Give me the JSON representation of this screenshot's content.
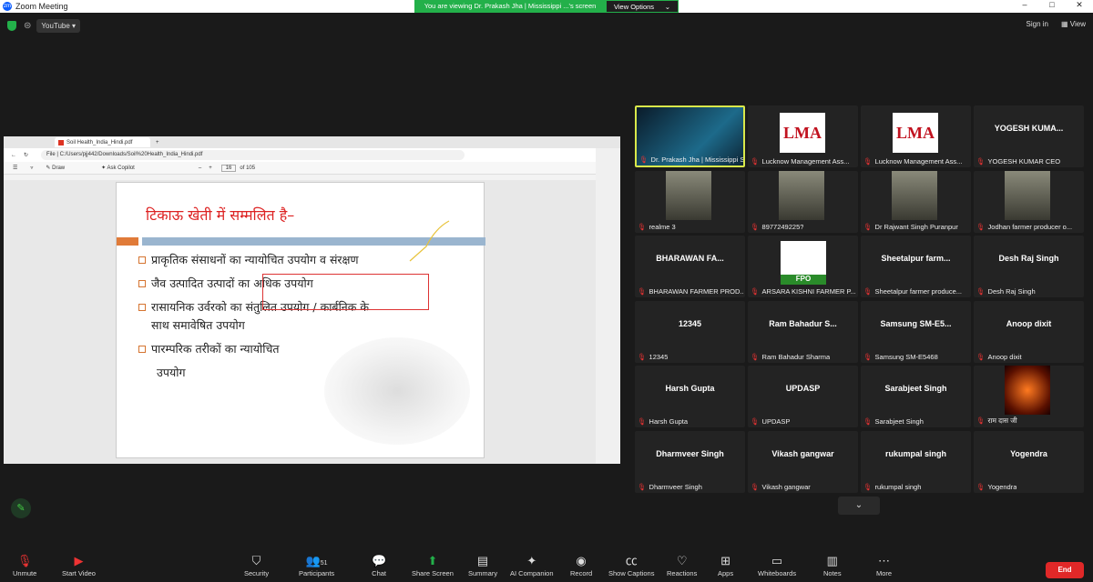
{
  "window": {
    "title": "Zoom Meeting",
    "controls": [
      "–",
      "□",
      "✕"
    ]
  },
  "banner": {
    "message": "You are viewing Dr. Prakash Jha | Mississippi ...'s screen",
    "view_options": "View Options"
  },
  "topbar": {
    "youtube": "YouTube",
    "sign_in": "Sign in",
    "view": "View"
  },
  "browser": {
    "tab_title": "Soil Health_India_Hindi.pdf",
    "address_prefix": "File",
    "address": "C:/Users/pjj442/Downloads/Soil%20Health_India_Hindi.pdf",
    "draw": "Draw",
    "ask_copilot": "Ask Copilot",
    "page_current": "16",
    "page_total": "of 105"
  },
  "slide": {
    "title": "टिकाऊ खेती में सम्मलित है–",
    "bullets": [
      "प्राकृतिक संसाधनों का न्यायोचित उपयोग व संरक्षण",
      "जैव उत्पादित उत्पादों का अधिक उपयोग",
      "रासायनिक उर्वरको का संतुलित उपयोग / कार्बनिक के",
      "साथ समावेषित उपयोग",
      "पारम्परिक तरीकों का न्यायोचित",
      "उपयोग"
    ]
  },
  "participants": [
    {
      "name_big": "",
      "label": "Dr. Prakash Jha | Mississippi S...",
      "type": "video-active"
    },
    {
      "name_big": "",
      "label": "Lucknow Management Ass...",
      "type": "lma"
    },
    {
      "name_big": "",
      "label": "Lucknow Management Ass...",
      "type": "lma"
    },
    {
      "name_big": "YOGESH KUMA...",
      "label": "YOGESH KUMAR CEO",
      "type": "name"
    },
    {
      "name_big": "",
      "label": "realme 3",
      "type": "photo"
    },
    {
      "name_big": "",
      "label": "8977249225?",
      "type": "photo"
    },
    {
      "name_big": "",
      "label": "Dr Rajwant Singh Puranpur",
      "type": "photo"
    },
    {
      "name_big": "",
      "label": "Jodhan farmer producer o...",
      "type": "photo"
    },
    {
      "name_big": "BHARAWAN FA...",
      "label": "BHARAWAN FARMER PROD...",
      "type": "name"
    },
    {
      "name_big": "",
      "label": "ARSARA KISHNI FARMER P...",
      "type": "fpo"
    },
    {
      "name_big": "Sheetalpur  farm...",
      "label": "Sheetalpur farmer produce...",
      "type": "name"
    },
    {
      "name_big": "Desh Raj Singh",
      "label": "Desh Raj Singh",
      "type": "name"
    },
    {
      "name_big": "12345",
      "label": "12345",
      "type": "name"
    },
    {
      "name_big": "Ram Bahadur S...",
      "label": "Ram Bahadur Sharma",
      "type": "name"
    },
    {
      "name_big": "Samsung  SM-E5...",
      "label": "Samsung SM-E5468",
      "type": "name"
    },
    {
      "name_big": "Anoop dixit",
      "label": "Anoop dixit",
      "type": "name"
    },
    {
      "name_big": "Harsh Gupta",
      "label": "Harsh Gupta",
      "type": "name"
    },
    {
      "name_big": "UPDASP",
      "label": "UPDASP",
      "type": "name"
    },
    {
      "name_big": "Sarabjeet Singh",
      "label": "Sarabjeet Singh",
      "type": "name"
    },
    {
      "name_big": "",
      "label": "राम दास जी",
      "type": "photo-fire"
    },
    {
      "name_big": "Dharmveer Singh",
      "label": "Dharmveer Singh",
      "type": "name"
    },
    {
      "name_big": "Vikash gangwar",
      "label": "Vikash gangwar",
      "type": "name"
    },
    {
      "name_big": "rukumpal singh",
      "label": "rukumpal singh",
      "type": "name"
    },
    {
      "name_big": "Yogendra",
      "label": "Yogendra",
      "type": "name"
    }
  ],
  "toolbar": {
    "unmute": "Unmute",
    "start_video": "Start Video",
    "security": "Security",
    "participants": "Participants",
    "participants_count": "51",
    "chat": "Chat",
    "share_screen": "Share Screen",
    "summary": "Summary",
    "ai_companion": "AI Companion",
    "record": "Record",
    "show_captions": "Show Captions",
    "reactions": "Reactions",
    "apps": "Apps",
    "whiteboards": "Whiteboards",
    "notes": "Notes",
    "more": "More",
    "end": "End"
  },
  "colors": {
    "share_green": "#23b04a",
    "end_red": "#e02828",
    "slide_title_red": "#d22222",
    "active_border": "#d9e84a"
  }
}
